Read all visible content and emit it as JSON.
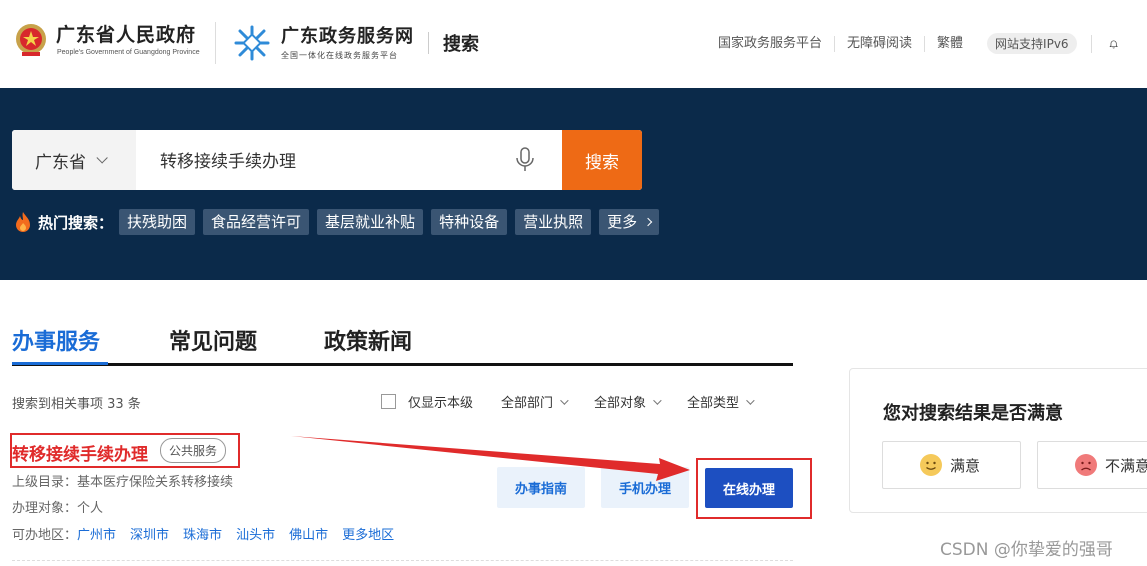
{
  "header": {
    "brand_title": "广东省人民政府",
    "brand_sub": "People's Government of Guangdong Province",
    "portal_title": "广东政务服务网",
    "portal_sub": "全国一体化在线政务服务平台",
    "page_title": "搜索",
    "links": [
      "国家政务服务平台",
      "无障碍阅读",
      "繁體"
    ],
    "ipv6_badge": "网站支持IPv6"
  },
  "search": {
    "region": "广东省",
    "query": "转移接续手续办理",
    "button": "搜索"
  },
  "hot": {
    "label": "热门搜索：",
    "tags": [
      "扶残助困",
      "食品经营许可",
      "基层就业补贴",
      "特种设备",
      "营业执照"
    ],
    "more": "更多"
  },
  "tabs": [
    "办事服务",
    "常见问题",
    "政策新闻"
  ],
  "filters": {
    "count_text": "搜索到相关事项 33 条",
    "only_level": "仅显示本级",
    "dept": "全部部门",
    "target": "全部对象",
    "type": "全部类型"
  },
  "result": {
    "title": "转移接续手续办理",
    "badge": "公共服务",
    "parent_label": "上级目录：",
    "parent_value": "基本医疗保险关系转移接续",
    "target_label": "办理对象：",
    "target_value": "个人",
    "region_label": "可办地区：",
    "regions": [
      "广州市",
      "深圳市",
      "珠海市",
      "汕头市",
      "佛山市",
      "更多地区"
    ],
    "btn_guide": "办事指南",
    "btn_mobile": "手机办理",
    "btn_online": "在线办理"
  },
  "satisfaction": {
    "title": "您对搜索结果是否满意",
    "yes": "满意",
    "no": "不满意"
  },
  "watermark": "CSDN @你挚爱的强哥",
  "colors": {
    "banner": "#0b2a4a",
    "accent_orange": "#ee6a15",
    "accent_blue": "#1a6cd6",
    "annotation_red": "#e02b2b"
  }
}
